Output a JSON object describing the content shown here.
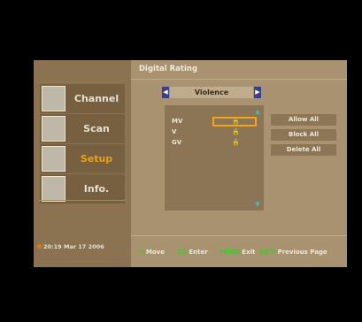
{
  "nav": {
    "items": [
      {
        "label": "Channel",
        "icon": "channel-thumbnail-icon",
        "active": false
      },
      {
        "label": "Scan",
        "icon": "satellite-dish-icon",
        "active": false
      },
      {
        "label": "Setup",
        "icon": "gear-icon",
        "active": true
      },
      {
        "label": "Info.",
        "icon": "info-magnifier-icon",
        "active": false
      }
    ],
    "clock": "20:19 Mar 17 2006"
  },
  "panel": {
    "title": "Digital Rating",
    "selector": {
      "value": "Violence",
      "left_icon": "triangle-left-icon",
      "right_icon": "triangle-right-icon"
    },
    "list": {
      "rows": [
        {
          "code": "MV",
          "icon": "lock-icon",
          "selected": true
        },
        {
          "code": "V",
          "icon": "lock-icon",
          "selected": false
        },
        {
          "code": "GV",
          "icon": "lock-icon",
          "selected": false
        }
      ],
      "scroll_up_icon": "scroll-up-icon",
      "scroll_down_icon": "scroll-down-icon"
    },
    "buttons": {
      "allow_all": "Allow All",
      "block_all": "Block All",
      "delete_all": "Delete All"
    }
  },
  "help": {
    "move_key": "✣",
    "move": "Move",
    "ok_key": "OK",
    "ok": "Enter",
    "exit_key": "MENU",
    "exit": "Exit",
    "prev_key": "EXIT",
    "prev": "Previous Page"
  },
  "colors": {
    "accent": "#e9a019",
    "selection": "#f2a51b",
    "key_green": "#45c431",
    "panel": "#a99270",
    "nav": "#8b7351"
  }
}
